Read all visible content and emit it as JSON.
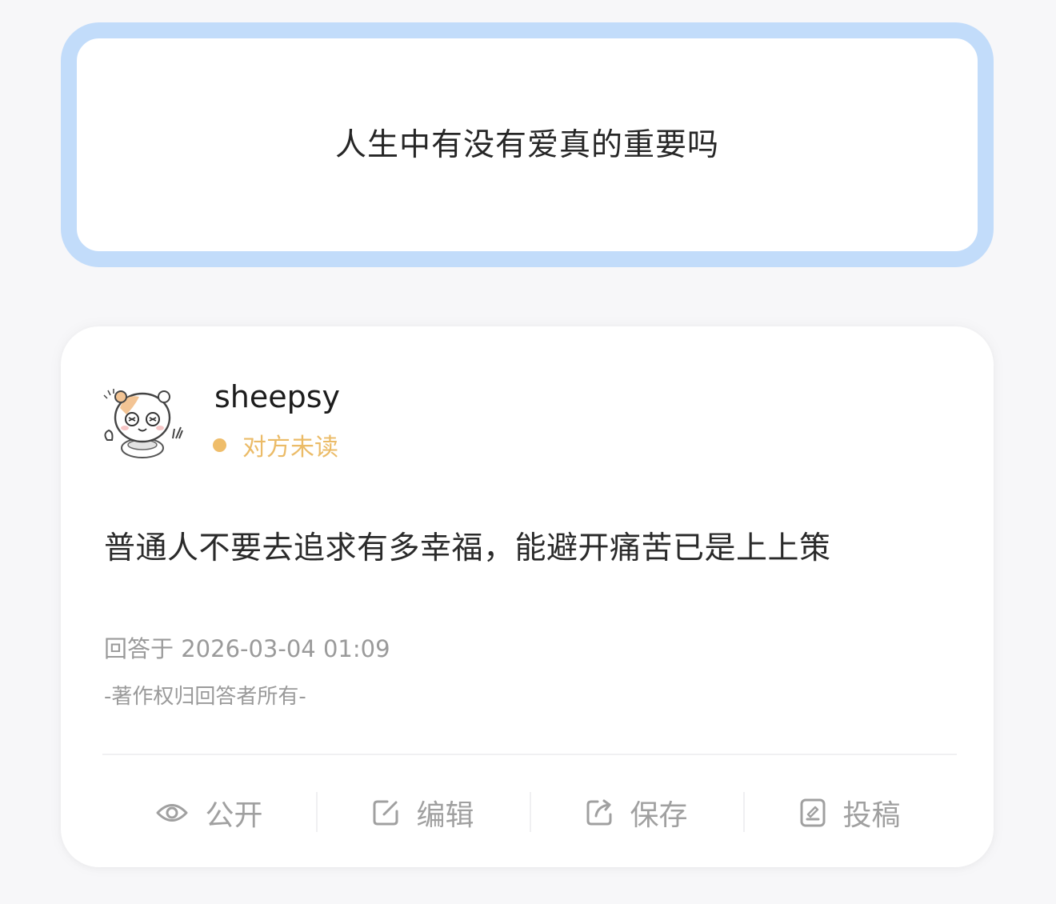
{
  "question": {
    "text": "人生中有没有爱真的重要吗"
  },
  "answer": {
    "username": "sheepsy",
    "read_status": "对方未读",
    "content": "普通人不要去追求有多幸福，能避开痛苦已是上上策",
    "answered_at": "回答于 2026-03-04 01:09",
    "copyright": "-著作权归回答者所有-"
  },
  "actions": [
    {
      "label": "公开",
      "icon": "eye-icon"
    },
    {
      "label": "编辑",
      "icon": "edit-icon"
    },
    {
      "label": "保存",
      "icon": "share-icon"
    },
    {
      "label": "投稿",
      "icon": "document-icon"
    }
  ],
  "colors": {
    "question_border": "#c2dcfa",
    "status_accent": "#efbd6a",
    "muted_text": "#9a9a9a"
  }
}
